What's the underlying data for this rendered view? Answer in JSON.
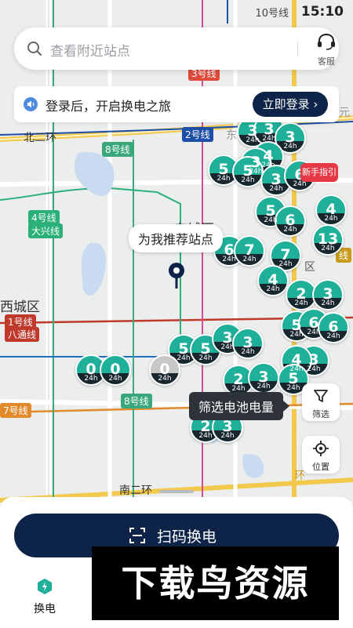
{
  "status": {
    "time": "15:10",
    "route_badge": "10号线"
  },
  "search": {
    "placeholder": "查看附近站点",
    "service_label": "客服"
  },
  "banner": {
    "text": "登录后，开启换电之旅",
    "login_button": "立即登录"
  },
  "map": {
    "labels": [
      "北二环",
      "东城区",
      "西城区",
      "南二环",
      "元",
      "东",
      "区",
      "环"
    ],
    "lines": [
      "2号线",
      "8号线",
      "4号线",
      "大兴线",
      "1号线",
      "八通线",
      "8号线",
      "7号线",
      "线",
      "3号线"
    ],
    "guide": "新手指引",
    "recommend_tooltip": "为我推荐站点",
    "filter_tooltip": "筛选电池电量",
    "stations": [
      {
        "v": "3",
        "h": "24h"
      },
      {
        "v": "3",
        "h": "24h"
      },
      {
        "v": "3",
        "h": "24h"
      },
      {
        "v": "4",
        "h": "24h"
      },
      {
        "v": "3",
        "h": "24h"
      },
      {
        "v": "5",
        "h": "24h"
      },
      {
        "v": "5",
        "h": "24h"
      },
      {
        "v": "3",
        "h": "24h"
      },
      {
        "v": "6",
        "h": "24h"
      },
      {
        "v": "5",
        "h": "24h"
      },
      {
        "v": "6",
        "h": "24h"
      },
      {
        "v": "4",
        "h": "24h"
      },
      {
        "v": "13",
        "h": "24h"
      },
      {
        "v": "6",
        "h": "24h"
      },
      {
        "v": "7",
        "h": "24h"
      },
      {
        "v": "7",
        "h": "24h"
      },
      {
        "v": "4",
        "h": "24h"
      },
      {
        "v": "2",
        "h": "24h"
      },
      {
        "v": "3",
        "h": "24h"
      },
      {
        "v": "5",
        "h": "24h"
      },
      {
        "v": "6",
        "h": "24h"
      },
      {
        "v": "6",
        "h": "24h"
      },
      {
        "v": "5",
        "h": "24h"
      },
      {
        "v": "5",
        "h": "24h"
      },
      {
        "v": "3",
        "h": "24h"
      },
      {
        "v": "3",
        "h": "24h"
      },
      {
        "v": "3",
        "h": "24h"
      },
      {
        "v": "4",
        "h": "24h"
      },
      {
        "v": "0",
        "h": "24h"
      },
      {
        "v": "0",
        "h": "24h"
      },
      {
        "v": "0",
        "h": "24h"
      },
      {
        "v": "2",
        "h": "24h"
      },
      {
        "v": "3",
        "h": "24h"
      },
      {
        "v": "5",
        "h": "24h"
      },
      {
        "v": "2",
        "h": "24h"
      },
      {
        "v": "3",
        "h": "24h"
      }
    ]
  },
  "side": {
    "filter_label": "筛选",
    "locate_label": "位置"
  },
  "bottom": {
    "scan_label": "扫码换电",
    "tab_label": "换电",
    "watermark": "下载鸟资源"
  }
}
